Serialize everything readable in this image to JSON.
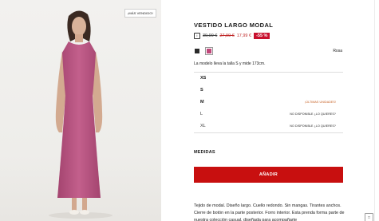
{
  "product": {
    "badge": "¡MÁS VENDIDO!",
    "title": "VESTIDO LARGO MODAL",
    "price_icon": "i",
    "price_original": "39,99 €",
    "price_previous": "27,99 €",
    "price_current": "17,99 €",
    "discount": "-55 %",
    "color_selected": "Rosa",
    "model_info": "La modelo lleva la talla S y mide 173cm."
  },
  "colors": [
    {
      "name": "black",
      "hex": "#2a2a2a"
    },
    {
      "name": "pink",
      "hex": "#c0487a"
    }
  ],
  "sizes": [
    {
      "label": "XS",
      "note": ""
    },
    {
      "label": "S",
      "note": ""
    },
    {
      "label": "M",
      "note": "¡ÚLTIMAS UNIDADES!"
    },
    {
      "label": "L",
      "note": "NO DISPONIBLE ¿LO QUIERES?"
    },
    {
      "label": "XL",
      "note": "NO DISPONIBLE ¿LO QUIERES?"
    }
  ],
  "measures_label": "MEDIDAS",
  "add_button": "AÑADIR",
  "description": "Tejido de modal. Diseño largo. Cuello redondo. Sin mangas. Tirantes anchos. Cierre de botón en la parte posterior. Forro interior. Esta prenda forma parte de nuestra colección casual, diseñada para acompañarte",
  "accent_colors": {
    "sale_red": "#c8102e",
    "button_red": "#c80f0f",
    "low_stock_orange": "#c4591a"
  },
  "icons": {
    "corner": "feedback-icon"
  }
}
